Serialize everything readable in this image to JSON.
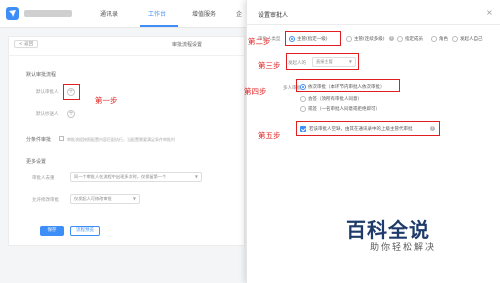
{
  "header": {
    "tabs": [
      {
        "label": "通讯录"
      },
      {
        "label": "工作台"
      },
      {
        "label": "增值服务"
      },
      {
        "label": "企"
      }
    ]
  },
  "left": {
    "back_label": "< 返回",
    "page_title": "审批流程设置",
    "section_default": "默认审批流程",
    "field_approver": "默认审批人",
    "field_cc": "默认抄送人",
    "section_branch": "分条件审批",
    "branch_desc": "审批流程按照配置内容匹配执行，当配置需要满足条件审批时",
    "section_more": "更多设置",
    "field_dedupe": "审批人去重",
    "dedupe_value": "同一个审批人在流程中出现多次时，仅保留第一个",
    "field_edit": "允许修改审批",
    "edit_value": "仅发起人可修改审批",
    "save_label": "保存",
    "preview_label": "流程预览"
  },
  "dialog": {
    "title": "设置审批人",
    "close": "×",
    "row_type_label": "审批人类型",
    "types": [
      {
        "label": "主管(指定一级)",
        "selected": true
      },
      {
        "label": "主管(连续多级)",
        "selected": false
      },
      {
        "label": "指定成员",
        "selected": false
      },
      {
        "label": "角色",
        "selected": false
      },
      {
        "label": "发起人自己",
        "selected": false
      }
    ],
    "row_initiator_label": "发起人的",
    "initiator_value": "直接主管",
    "row_method_label": "多人审批时",
    "methods": [
      {
        "label": "依次审批（本环节内审批人依次审批）",
        "selected": true
      },
      {
        "label": "会签（须所有审批人同意）",
        "selected": false
      },
      {
        "label": "或签（一名审批人同意或拒绝即可）",
        "selected": false
      }
    ],
    "fallback_label": "若该审批人空缺，由其在通讯录中的上级主管代审批"
  },
  "annotations": {
    "step1": "第一步",
    "step2": "第二步",
    "step3": "第三步",
    "step4": "第四步",
    "step5": "第五步"
  },
  "watermark": {
    "main": "百科全说",
    "sub": "助你轻松解决"
  },
  "colors": {
    "accent": "#3e8ef7",
    "annotation": "#e02020",
    "watermark": "#1f3b6b"
  }
}
